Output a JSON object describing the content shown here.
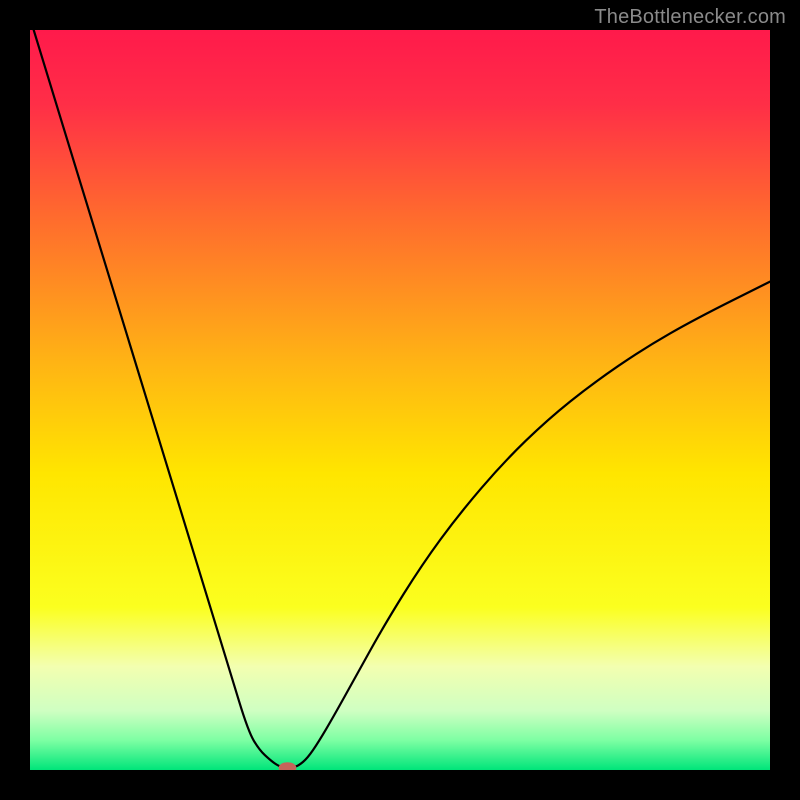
{
  "watermark": "TheBottlenecker.com",
  "chart_data": {
    "type": "line",
    "title": "",
    "xlabel": "",
    "ylabel": "",
    "xlim": [
      0,
      100
    ],
    "ylim": [
      0,
      100
    ],
    "gradient_stops": [
      {
        "offset": 0.0,
        "color": "#ff1a4b"
      },
      {
        "offset": 0.1,
        "color": "#ff2e47"
      },
      {
        "offset": 0.25,
        "color": "#ff6a2e"
      },
      {
        "offset": 0.45,
        "color": "#ffb414"
      },
      {
        "offset": 0.6,
        "color": "#ffe600"
      },
      {
        "offset": 0.78,
        "color": "#fbff1f"
      },
      {
        "offset": 0.86,
        "color": "#f3ffb0"
      },
      {
        "offset": 0.92,
        "color": "#cfffc2"
      },
      {
        "offset": 0.96,
        "color": "#7dffa3"
      },
      {
        "offset": 1.0,
        "color": "#00e57a"
      }
    ],
    "series": [
      {
        "name": "curve",
        "x": [
          0.5,
          3,
          6,
          9,
          12,
          15,
          18,
          21,
          24,
          27,
          29.5,
          31,
          32.5,
          33.5,
          34,
          34.8,
          35.5,
          36.3,
          37.5,
          39,
          41,
          44,
          48,
          53,
          58,
          64,
          70,
          76,
          83,
          90,
          100
        ],
        "y": [
          100,
          91.8,
          82,
          72.2,
          62.4,
          52.6,
          42.8,
          33,
          23.2,
          13.4,
          5.2,
          2.7,
          1.3,
          0.6,
          0.45,
          0.3,
          0.35,
          0.6,
          1.6,
          3.8,
          7.2,
          12.6,
          19.8,
          27.8,
          34.6,
          41.6,
          47.4,
          52.2,
          57,
          61,
          66
        ]
      }
    ],
    "marker": {
      "x": 34.8,
      "y": 0.3,
      "rx": 1.2,
      "ry": 0.75,
      "color": "#c5655a"
    }
  }
}
